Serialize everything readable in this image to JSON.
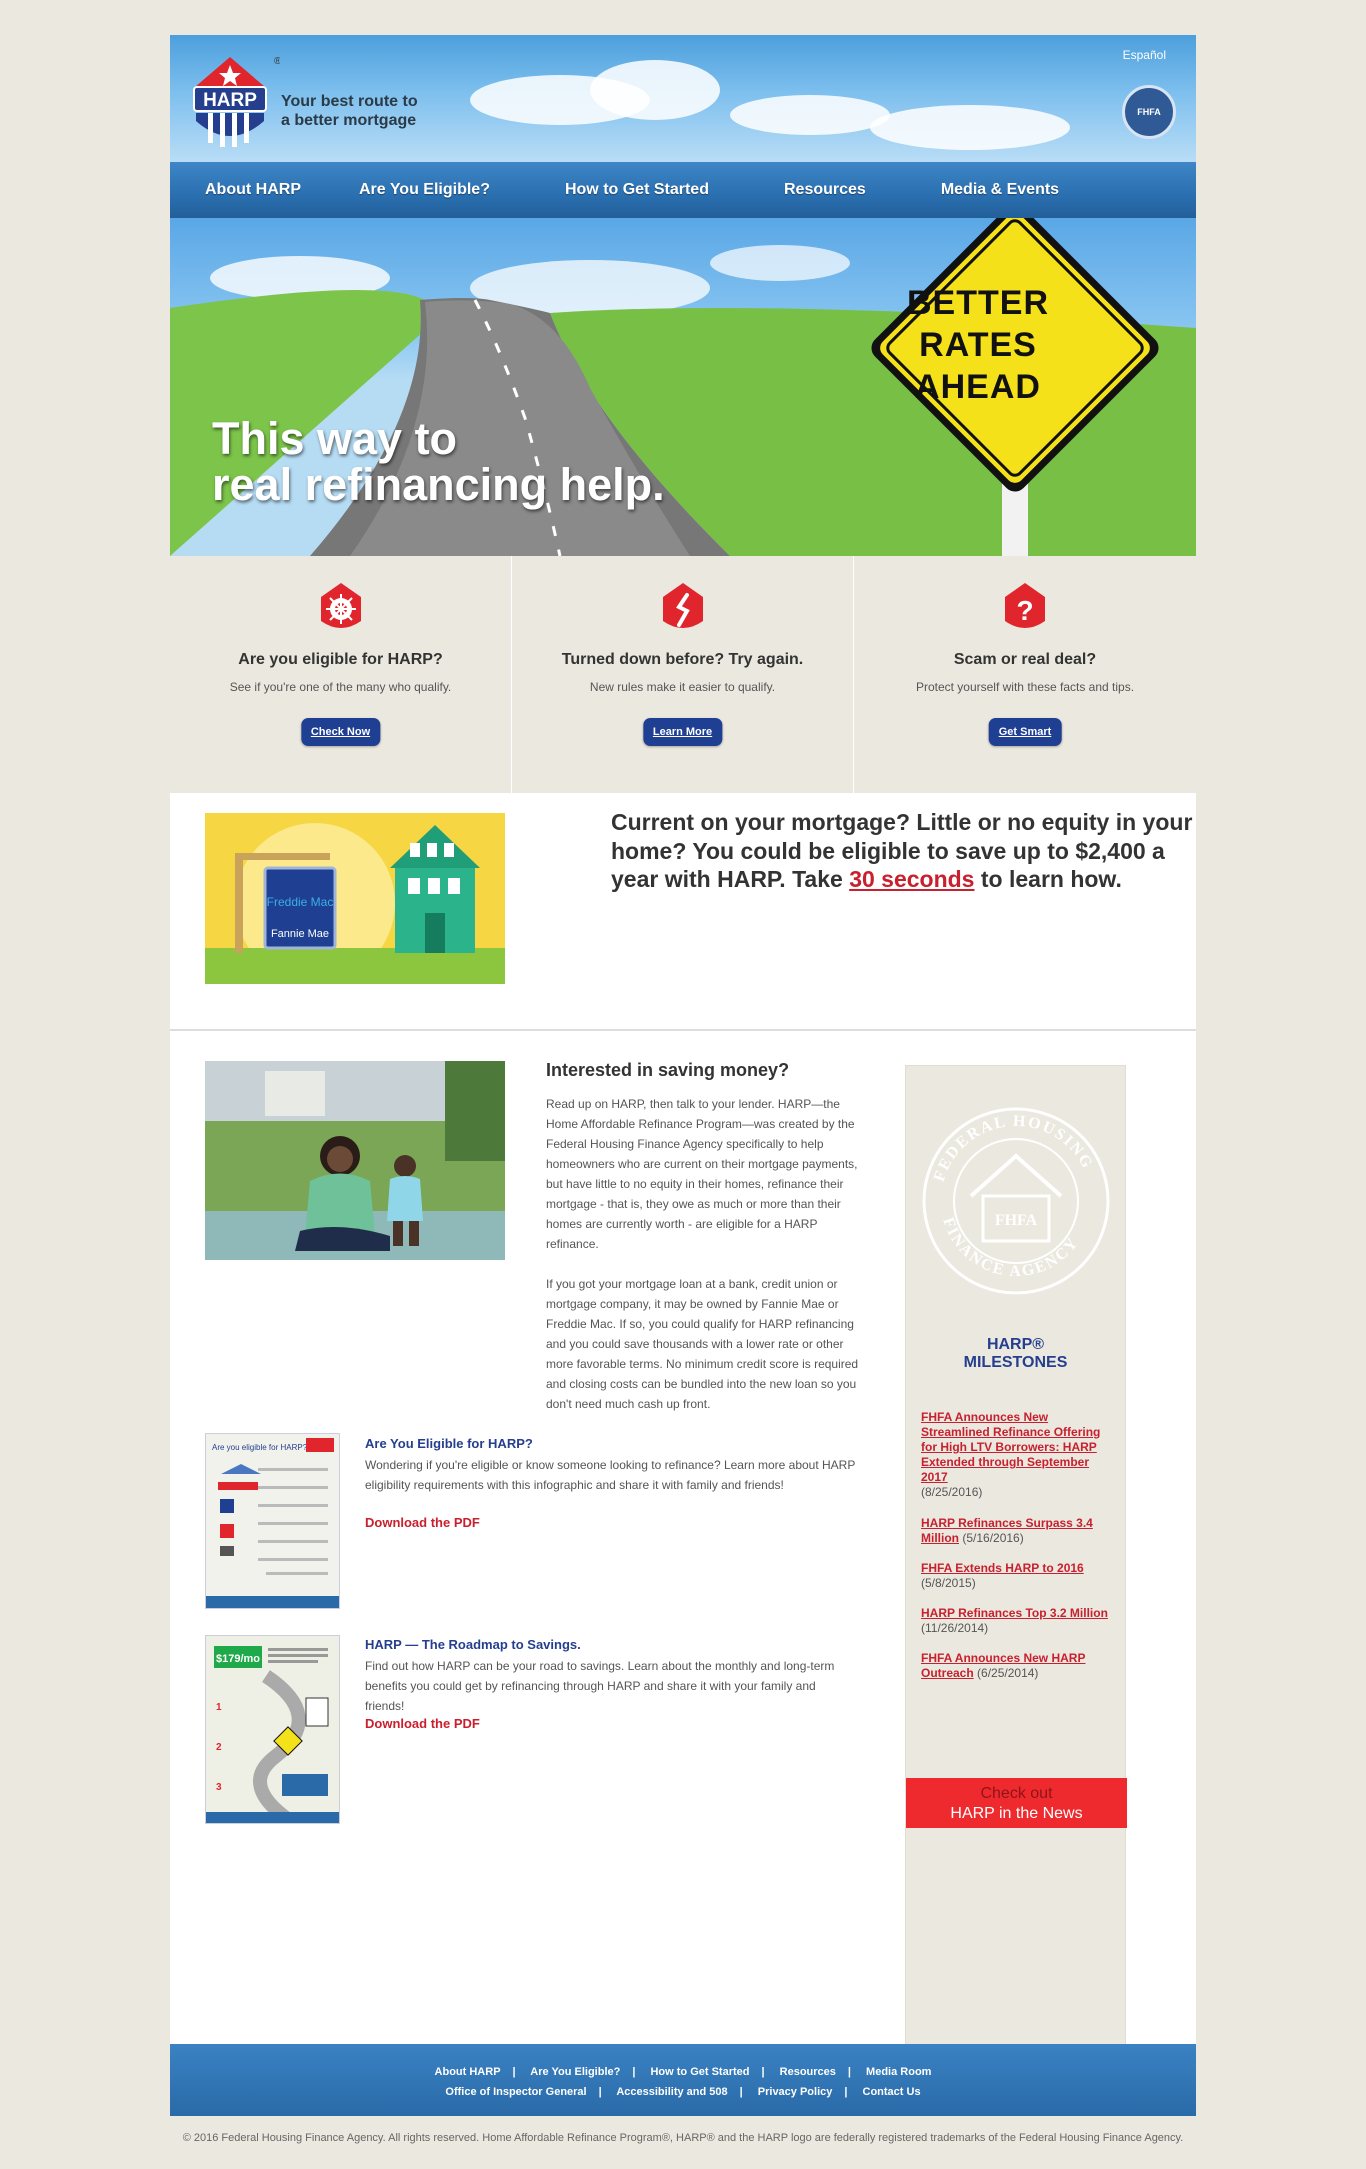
{
  "header": {
    "logo_text": "HARP",
    "tagline_line1": "Your best route to",
    "tagline_line2": "a better mortgage",
    "language_link": "Español"
  },
  "nav": {
    "items": [
      {
        "label": "About HARP"
      },
      {
        "label": "Are You Eligible?"
      },
      {
        "label": "How to Get Started"
      },
      {
        "label": "Resources"
      },
      {
        "label": "Media & Events"
      }
    ]
  },
  "hero": {
    "headline_line1": "This way to",
    "headline_line2": "real refinancing help.",
    "sign_line1": "BETTER",
    "sign_line2": "RATES",
    "sign_line3": "AHEAD"
  },
  "features": [
    {
      "icon": "sunburst-icon",
      "title": "Are you eligible for HARP?",
      "description": "See if you're one of the many who qualify.",
      "button": "Check Now"
    },
    {
      "icon": "dollar-icon",
      "title": "Turned down before? Try again.",
      "description": "New rules make it easier to qualify.",
      "button": "Learn More"
    },
    {
      "icon": "question-icon",
      "title": "Scam or real deal?",
      "description": "Protect yourself with these facts and tips.",
      "button": "Get Smart"
    }
  ],
  "promo": {
    "sign_top": "Freddie Mac",
    "sign_bottom": "Fannie Mae",
    "text_before": "Current on your mortgage? Little or no equity in your home? You could be eligible to save up to $2,400 a year with HARP. Take ",
    "link_text": "30 seconds",
    "text_after": " to learn how."
  },
  "main": {
    "title": "Interested in saving money?",
    "paragraph1": "Read up on HARP, then talk to your lender. HARP—the Home Affordable Refinance Program—was created by the Federal Housing Finance Agency specifically to help homeowners who are current on their mortgage payments, but have little to no equity in their homes, refinance their mortgage - that is, they owe as much or more than their homes are currently worth - are eligible for a HARP refinance.",
    "paragraph2": "If you got your mortgage loan at a bank, credit union or mortgage company, it may be owned by Fannie Mae or Freddie Mac. If so, you could qualify for HARP refinancing and you could save thousands with a lower rate or other more favorable terms. No minimum credit score is required and closing costs can be bundled into the new loan so you don't need much cash up front."
  },
  "documents": [
    {
      "title": "Are You Eligible for HARP?",
      "description": "Wondering if you're eligible or know someone looking to refinance? Learn more about HARP eligibility requirements with this infographic and share it with family and friends!",
      "link": "Download the PDF",
      "thumb_heading": "Are you eligible for HARP?"
    },
    {
      "title": "HARP — The Roadmap to Savings.",
      "description": "Find out how HARP can be your road to savings. Learn about the monthly and long-term benefits you could get by refinancing through HARP and share it with your family and friends!",
      "link": "Download the PDF",
      "thumb_heading": "$179/mo"
    }
  ],
  "sidebar": {
    "seal_label": "FHFA",
    "milestones_title_line1": "HARP®",
    "milestones_title_line2": "MILESTONES",
    "milestones": [
      {
        "title": "FHFA Announces New Streamlined Refinance Offering for High LTV Borrowers: HARP Extended through September 2017",
        "date": "(8/25/2016)"
      },
      {
        "title": "HARP Refinances Surpass 3.4 Million",
        "date": "(5/16/2016)"
      },
      {
        "title": "FHFA Extends HARP to 2016",
        "date": "(5/8/2015)"
      },
      {
        "title": "HARP Refinances Top 3.2 Million",
        "date": "(11/26/2014)"
      },
      {
        "title": "FHFA Announces New HARP Outreach",
        "date": "(6/25/2014)"
      }
    ],
    "news_line1": "Check out",
    "news_line2": "HARP in the News"
  },
  "footer": {
    "row1": [
      "About HARP",
      "Are You Eligible?",
      "How to Get Started",
      "Resources",
      "Media Room"
    ],
    "row2": [
      "Office of Inspector General",
      "Accessibility and 508",
      "Privacy Policy",
      "Contact Us"
    ],
    "copyright": "© 2016 Federal Housing Finance Agency. All rights reserved. Home Affordable Refinance Program®, HARP® and the HARP logo are federally registered trademarks of the Federal Housing Finance Agency."
  },
  "colors": {
    "brand_blue": "#253f8e",
    "accent_red": "#c8202e",
    "nav_blue": "#2a6fb0",
    "background": "#ebe8df"
  }
}
